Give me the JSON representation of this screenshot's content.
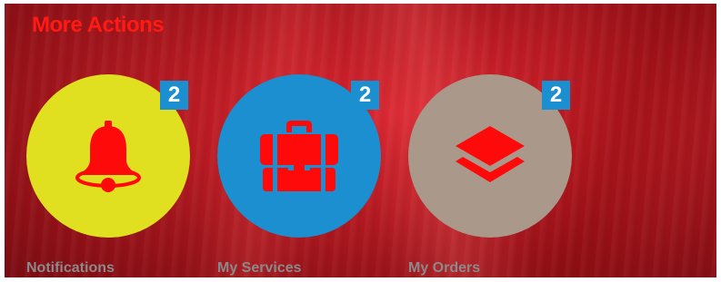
{
  "section": {
    "title": "More Actions"
  },
  "tiles": [
    {
      "label": "Notifications",
      "badge": "2",
      "icon": "bell-icon",
      "circle_color": "#e0e020"
    },
    {
      "label": "My Services",
      "badge": "2",
      "icon": "briefcase-icon",
      "circle_color": "#1b8fd0"
    },
    {
      "label": "My Orders",
      "badge": "2",
      "icon": "layers-icon",
      "circle_color": "#aa998a"
    }
  ],
  "colors": {
    "title": "#ff1a14",
    "icon": "#ff0a0a",
    "badge_bg": "#1b8fd0",
    "badge_text": "#ffffff",
    "label": "#8a8a8a",
    "background": "#b81a22"
  }
}
